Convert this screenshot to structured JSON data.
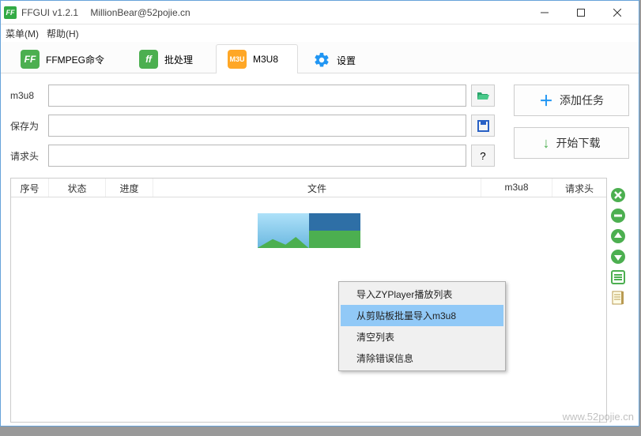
{
  "window": {
    "app_name": "FFGUI",
    "version": "v1.2.1",
    "author": "MillionBear@52pojie.cn"
  },
  "menu": {
    "m1": "菜单(M)",
    "m2": "帮助(H)"
  },
  "tabs": {
    "ffmpeg": "FFMPEG命令",
    "batch": "批处理",
    "m3u8": "M3U8",
    "settings": "设置"
  },
  "form": {
    "m3u8_label": "m3u8",
    "saveas_label": "保存为",
    "headers_label": "请求头",
    "m3u8_value": "",
    "saveas_value": "",
    "headers_value": "",
    "question": "?"
  },
  "buttons": {
    "add": "添加任务",
    "start": "开始下载"
  },
  "table": {
    "headers": [
      "序号",
      "状态",
      "进度",
      "文件",
      "m3u8",
      "请求头"
    ]
  },
  "context_menu": {
    "items": [
      "导入ZYPlayer播放列表",
      "从剪贴板批量导入m3u8",
      "清空列表",
      "清除错误信息"
    ],
    "highlighted_index": 1
  },
  "watermark": "www.52pojie.cn"
}
